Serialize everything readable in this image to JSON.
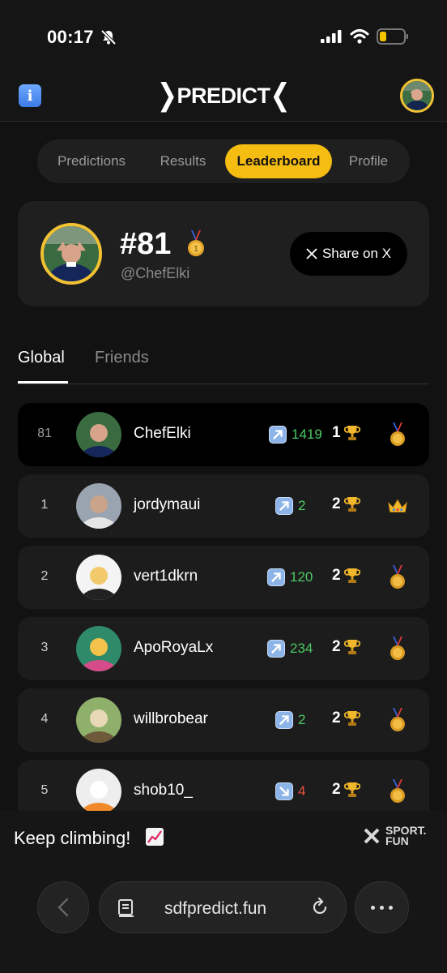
{
  "status": {
    "time": "00:17"
  },
  "header": {
    "logo": "PREDICT"
  },
  "tabs": [
    {
      "label": "Predictions",
      "active": false
    },
    {
      "label": "Results",
      "active": false
    },
    {
      "label": "Leaderboard",
      "active": true
    },
    {
      "label": "Profile",
      "active": false
    }
  ],
  "profile": {
    "rank": "#81",
    "handle": "@ChefElki",
    "share_label": "Share on X"
  },
  "sub_tabs": {
    "global": "Global",
    "friends": "Friends"
  },
  "leaderboard": [
    {
      "rank": "81",
      "name": "ChefElki",
      "change": "1419",
      "direction": "up",
      "trophies": "1",
      "badge": "gold-medal-icon",
      "me": true
    },
    {
      "rank": "1",
      "name": "jordymaui",
      "change": "2",
      "direction": "up",
      "trophies": "2",
      "badge": "crown-icon",
      "me": false
    },
    {
      "rank": "2",
      "name": "vert1dkrn",
      "change": "120",
      "direction": "up",
      "trophies": "2",
      "badge": "gold-medal-icon",
      "me": false
    },
    {
      "rank": "3",
      "name": "ApoRoyaLx",
      "change": "234",
      "direction": "up",
      "trophies": "2",
      "badge": "gold-medal-icon",
      "me": false
    },
    {
      "rank": "4",
      "name": "willbrobear",
      "change": "2",
      "direction": "up",
      "trophies": "2",
      "badge": "gold-medal-icon",
      "me": false
    },
    {
      "rank": "5",
      "name": "shob10_",
      "change": "4",
      "direction": "down",
      "trophies": "2",
      "badge": "gold-medal-icon",
      "me": false
    }
  ],
  "footer": {
    "message": "Keep climbing!",
    "brand_line1": "SPORT.",
    "brand_line2": "FUN"
  },
  "browser": {
    "url": "sdfpredict.fun"
  },
  "colors": {
    "accent": "#f5bc12",
    "up": "#4cc864",
    "down": "#e8503c",
    "avatar_ring": "#f2c233"
  }
}
